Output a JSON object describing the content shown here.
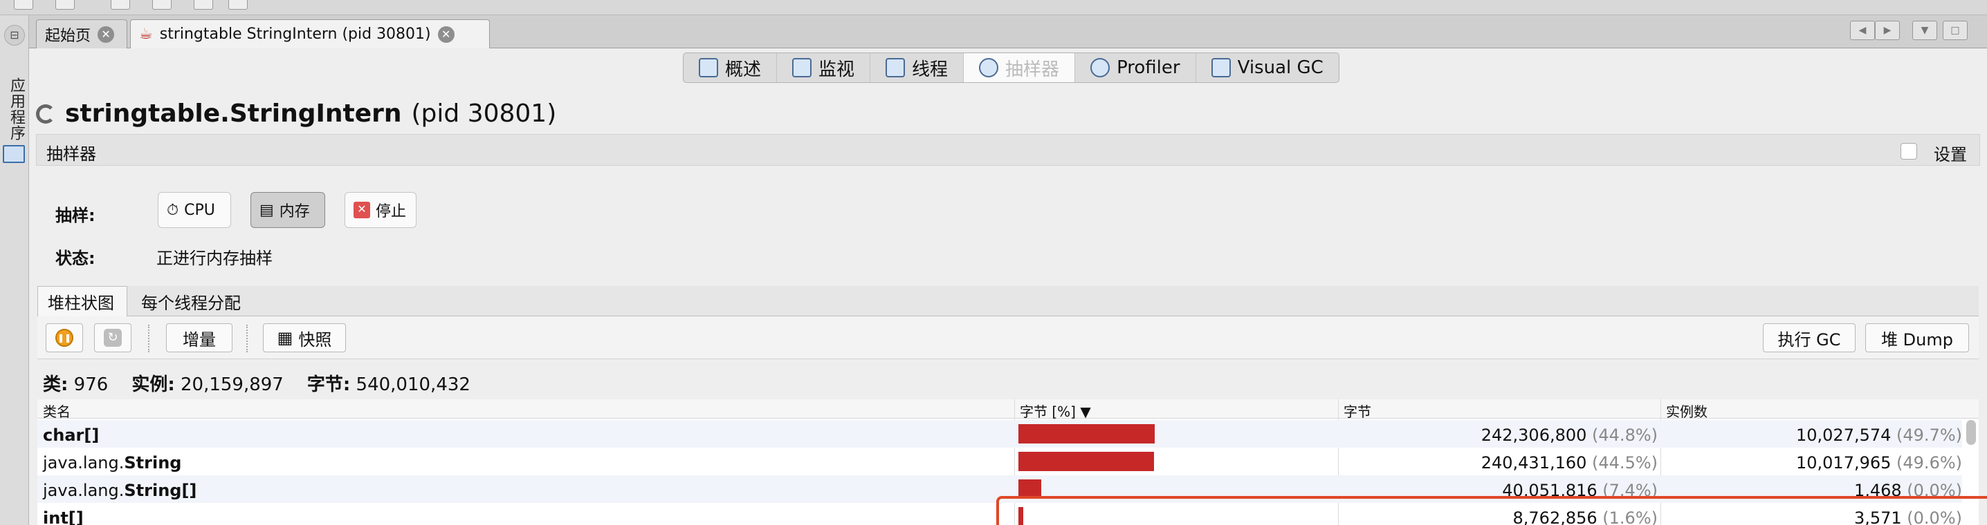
{
  "tabs": [
    {
      "label": "起始页"
    },
    {
      "label": "stringtable StringIntern (pid 30801)"
    }
  ],
  "rail": {
    "label": "应用程序"
  },
  "views": [
    {
      "label": "概述"
    },
    {
      "label": "监视"
    },
    {
      "label": "线程"
    },
    {
      "label": "抽样器"
    },
    {
      "label": "Profiler"
    },
    {
      "label": "Visual GC"
    }
  ],
  "title": {
    "name": "stringtable.StringIntern",
    "pid": "(pid 30801)"
  },
  "sampler": {
    "header": "抽样器",
    "settings_label": "设置",
    "sample_label": "抽样:",
    "buttons": {
      "cpu": "CPU",
      "memory": "内存",
      "stop": "停止"
    },
    "state_label": "状态:",
    "state_value": "正进行内存抽样"
  },
  "lower_tabs": [
    {
      "label": "堆柱状图"
    },
    {
      "label": "每个线程分配"
    }
  ],
  "actions": {
    "delta": "增量",
    "snapshot": "快照",
    "gc": "执行 GC",
    "heap_dump": "堆 Dump"
  },
  "summary": {
    "classes_label": "类:",
    "classes": "976",
    "instances_label": "实例:",
    "instances": "20,159,897",
    "bytes_label": "字节:",
    "bytes": "540,010,432"
  },
  "table": {
    "columns": [
      "类名",
      "字节 [%]",
      "字节",
      "实例数"
    ],
    "rows": [
      {
        "name_pre": "",
        "name_bold": "char[]",
        "bar_pct": 44.8,
        "bytes": "242,306,800",
        "bytes_pct": "(44.8%)",
        "instances": "10,027,574",
        "instances_pct": "(49.7%)"
      },
      {
        "name_pre": "java.lang.",
        "name_bold": "String",
        "bar_pct": 44.5,
        "bytes": "240,431,160",
        "bytes_pct": "(44.5%)",
        "instances": "10,017,965",
        "instances_pct": "(49.6%)"
      },
      {
        "name_pre": "java.lang.",
        "name_bold": "String[]",
        "bar_pct": 7.4,
        "bytes": "40,051,816",
        "bytes_pct": "(7.4%)",
        "instances": "1,468",
        "instances_pct": "(0.0%)"
      },
      {
        "name_pre": "",
        "name_bold": "int[]",
        "bar_pct": 1.6,
        "bytes": "8,762,856",
        "bytes_pct": "(1.6%)",
        "instances": "3,571",
        "instances_pct": "(0.0%)"
      }
    ]
  },
  "colors": {
    "bar": "#c62828",
    "highlight": "#e04828"
  }
}
